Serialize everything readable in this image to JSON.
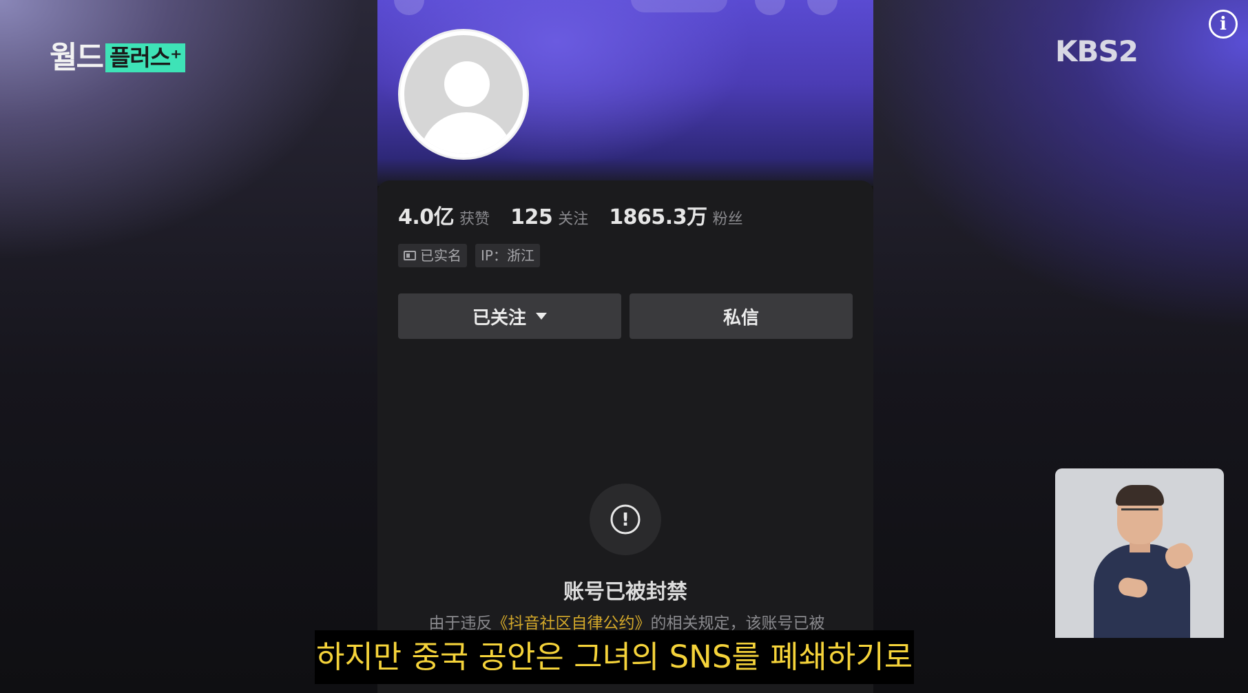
{
  "broadcast": {
    "logo_main": "월드",
    "logo_tag": "플러스⁺",
    "channel_logo": "KBS2",
    "info_icon": "i"
  },
  "profile": {
    "stats": [
      {
        "value": "4.0亿",
        "label": "获赞"
      },
      {
        "value": "125",
        "label": "关注"
      },
      {
        "value": "1865.3万",
        "label": "粉丝"
      }
    ],
    "tags": [
      "已实名",
      "IP：浙江"
    ],
    "follow_button": "已关注",
    "message_button": "私信",
    "ban_icon": "!",
    "ban_title": "账号已被封禁",
    "ban_desc_prefix": "由于违反",
    "ban_desc_highlight": "《抖音社区自律公约》",
    "ban_desc_suffix": "的相关规定，该账号已被封禁"
  },
  "subtitle": "하지만 중국 공안은 그녀의 SNS를 폐쇄하기로"
}
